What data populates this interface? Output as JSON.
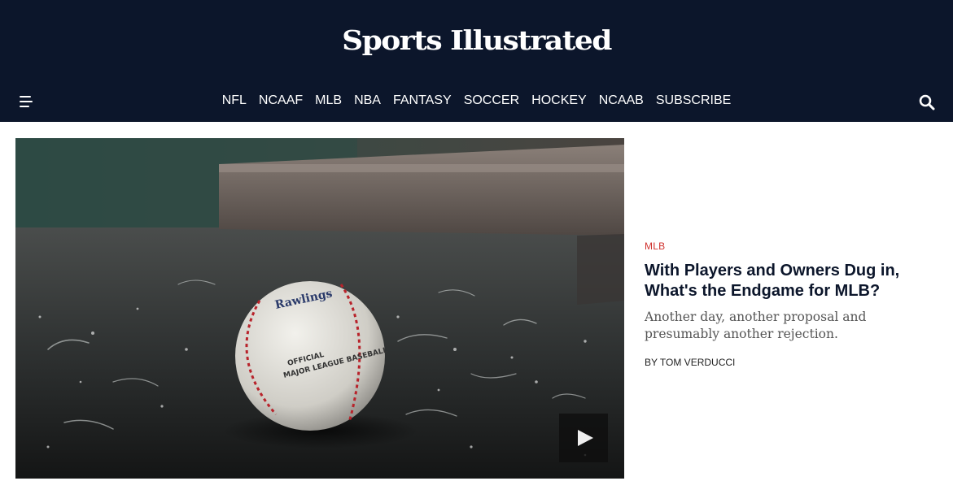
{
  "header": {
    "logo_text": "Sports Illustrated",
    "nav": [
      "NFL",
      "NCAAF",
      "MLB",
      "NBA",
      "FANTASY",
      "SOCCER",
      "HOCKEY",
      "NCAAB",
      "SUBSCRIBE"
    ],
    "menu_icon": "hamburger-menu-icon",
    "search_icon": "magnifier-icon"
  },
  "story": {
    "category": "MLB",
    "headline": "With Players and Owners Dug in, What's the Endgame for MLB?",
    "dek": "Another day, another proposal and presumably another rejection.",
    "byline": "BY TOM VERDUCCI",
    "media_icon": "play-icon"
  },
  "colors": {
    "header_bg": "#0c162b",
    "accent": "#d0312d",
    "headline": "#0c162b",
    "dek": "#555555"
  }
}
